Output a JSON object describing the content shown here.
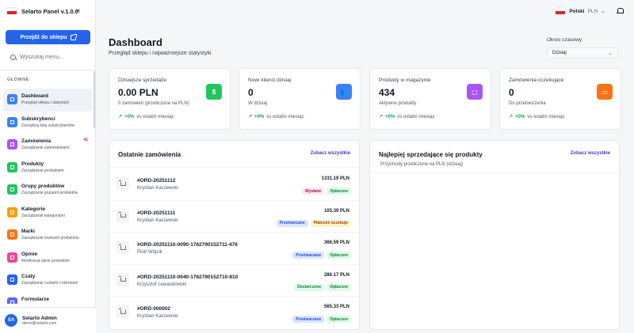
{
  "sidebar": {
    "brand": "Selarto Panel v.1.0.0",
    "collapse": "«",
    "shop_button": "Przejdź do sklepu",
    "search_placeholder": "Wyszukaj menu...",
    "section_label": "GŁÓWNE",
    "items": [
      {
        "label": "Dashboard",
        "sub": "Przegląd sklepu i statystyki",
        "color": "#3b82f6",
        "active": true,
        "badge": ""
      },
      {
        "label": "Subskrybenci",
        "sub": "Zarządzaj listą subskrybentów",
        "color": "#3b82f6",
        "active": false,
        "badge": ""
      },
      {
        "label": "Zamówienia",
        "sub": "Zarządzanie zamówieniami",
        "color": "#a855f7",
        "active": false,
        "badge": "41"
      },
      {
        "label": "Produkty",
        "sub": "Zarządzanie produktami",
        "color": "#22c55e",
        "active": false,
        "badge": ""
      },
      {
        "label": "Grupy produktów",
        "sub": "Zarządzanie grupami produktów",
        "color": "#22c55e",
        "active": false,
        "badge": ""
      },
      {
        "label": "Kategorie",
        "sub": "Zarządzanie kategoriami",
        "color": "#f59e0b",
        "active": false,
        "badge": ""
      },
      {
        "label": "Marki",
        "sub": "Zarządzanie markami produktów",
        "color": "#f97316",
        "active": false,
        "badge": ""
      },
      {
        "label": "Opinie",
        "sub": "Moderacja opinii produktów",
        "color": "#ec4899",
        "active": false,
        "badge": ""
      },
      {
        "label": "Czaty",
        "sub": "Zarządzanie czatami z klientami",
        "color": "#2563eb",
        "active": false,
        "badge": ""
      },
      {
        "label": "Formularze",
        "sub": "",
        "color": "#6366f1",
        "active": false,
        "badge": ""
      }
    ],
    "user": {
      "initials": "SA",
      "name": "Selarto Admin",
      "email": "demo@selarto.com"
    }
  },
  "topbar": {
    "language": "Polski",
    "currency": "PLN"
  },
  "header": {
    "title": "Dashboard",
    "subtitle": "Przegląd sklepu i najważniejsze statystyki",
    "period_label": "Okres czasowy",
    "period_value": "Dzisiaj"
  },
  "stats": [
    {
      "title": "Dzisiejsze sprzedaże",
      "value": "0.00 PLN",
      "sub": "0 zamówień (przeliczone na PLN)",
      "trend": "+0%",
      "trend_text": "vs ostatni miesiąc",
      "icon": "dollar-icon",
      "color": "#22c55e",
      "glyph": "$"
    },
    {
      "title": "Nowi klienci dzisiaj",
      "value": "0",
      "sub": "W dzisiaj",
      "trend": "+0%",
      "trend_text": "vs ostatni miesiąc",
      "icon": "users-icon",
      "color": "#3b82f6",
      "glyph": "👥"
    },
    {
      "title": "Produkty w magazynie",
      "value": "434",
      "sub": "Aktywne produkty",
      "trend": "+0%",
      "trend_text": "vs ostatni miesiąc",
      "icon": "bag-icon",
      "color": "#a855f7",
      "glyph": "▢"
    },
    {
      "title": "Zamówienia oczekujące",
      "value": "0",
      "sub": "Do przetworzenia",
      "trend": "+0%",
      "trend_text": "vs ostatni miesiąc",
      "icon": "truck-icon",
      "color": "#f97316",
      "glyph": "▭"
    }
  ],
  "orders_panel": {
    "title": "Ostatnie zamówienia",
    "link": "Zobacz wszystkie",
    "orders": [
      {
        "id": "#ORD-20251112",
        "customer": "Krystian Kaczewski",
        "amount": "1331.19 PLN",
        "badges": [
          {
            "text": "Wysłane",
            "cls": "b-pink"
          },
          {
            "text": "Opłacone",
            "cls": "b-green"
          }
        ]
      },
      {
        "id": "#ORD-20251111",
        "customer": "Krystian Kaczewski",
        "amount": "105.39 PLN",
        "badges": [
          {
            "text": "Przetwarzane",
            "cls": "b-blue"
          },
          {
            "text": "Płatność oczekuje",
            "cls": "b-yellow"
          }
        ]
      },
      {
        "id": "#ORD-20251110-0090-1762790152711-476",
        "customer": "Piotr Wójcik",
        "amount": "366.59 PLN",
        "badges": [
          {
            "text": "Przetwarzane",
            "cls": "b-blue"
          },
          {
            "text": "Opłacone",
            "cls": "b-green"
          }
        ]
      },
      {
        "id": "#ORD-20251110-0040-1762790152710-810",
        "customer": "Krzysztof Lewandowski",
        "amount": "286.17 PLN",
        "badges": [
          {
            "text": "Dostarczone",
            "cls": "b-green"
          },
          {
            "text": "Opłacone",
            "cls": "b-green"
          }
        ]
      },
      {
        "id": "#ORD-000002",
        "customer": "Krystian Kaczewski",
        "amount": "565.33 PLN",
        "badges": [
          {
            "text": "Przetwarzane",
            "cls": "b-blue"
          },
          {
            "text": "Opłacone",
            "cls": "b-green"
          }
        ]
      }
    ]
  },
  "products_panel": {
    "title": "Najlepiej sprzedające się produkty",
    "subtitle": "Przychody przeliczone na PLN (dzisiaj)",
    "link": "Zobacz wszystkie"
  }
}
